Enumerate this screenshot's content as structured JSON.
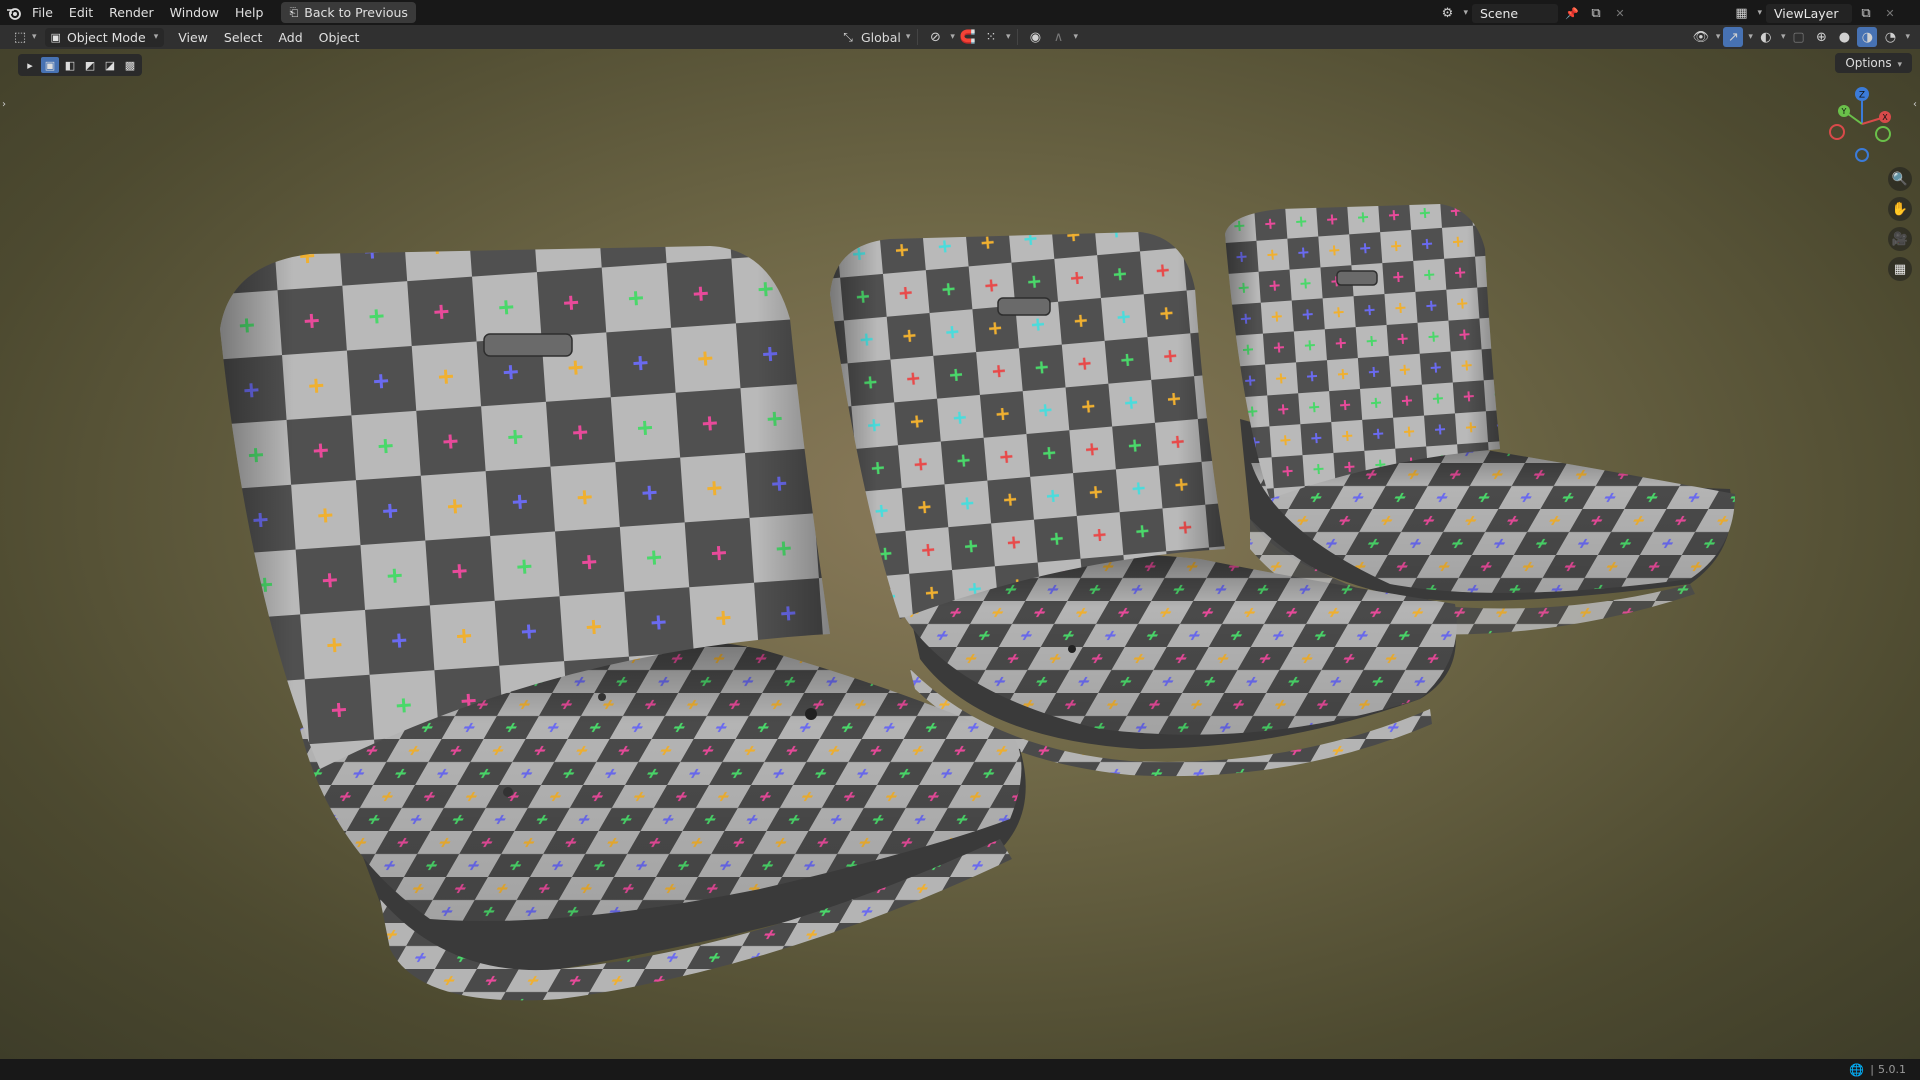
{
  "menubar": {
    "items": [
      "File",
      "Edit",
      "Render",
      "Window",
      "Help"
    ],
    "back_button": "Back to Previous",
    "scene_label": "Scene",
    "viewlayer_label": "ViewLayer"
  },
  "header": {
    "mode": "Object Mode",
    "menus": [
      "View",
      "Select",
      "Add",
      "Object"
    ],
    "transform_orientation": "Global"
  },
  "viewport": {
    "options_label": "Options",
    "gizmo": {
      "x": "X",
      "y": "Y",
      "z": "Z"
    }
  },
  "statusbar": {
    "version": "5.0.1"
  },
  "colors": {
    "accent": "#4772b3",
    "checker_light": "#b9b9b9",
    "checker_dark": "#4f4f4f"
  }
}
